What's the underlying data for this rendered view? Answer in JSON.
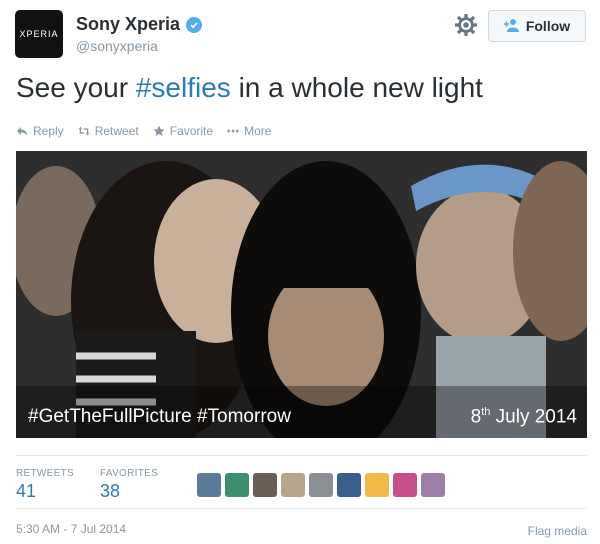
{
  "account": {
    "avatar_text": "XPERIA",
    "display_name": "Sony Xperia",
    "handle": "@sonyxperia",
    "verified": true,
    "follow_label": "Follow"
  },
  "tweet": {
    "text_before": "See your ",
    "hashtag": "#selfies",
    "text_after": " in a whole new light"
  },
  "actions": [
    {
      "label": "Reply",
      "icon": "reply-icon"
    },
    {
      "label": "Retweet",
      "icon": "retweet-icon"
    },
    {
      "label": "Favorite",
      "icon": "star-icon"
    },
    {
      "label": "More",
      "icon": "more-icon"
    }
  ],
  "media": {
    "caption_left": "#GetTheFullPicture #Tomorrow",
    "caption_right_day": "8",
    "caption_right_suffix": "th",
    "caption_right_rest": " July 2014"
  },
  "stats": {
    "retweets_label": "RETWEETS",
    "retweets_value": "41",
    "favorites_label": "FAVORITES",
    "favorites_value": "38"
  },
  "favoriters_colors": [
    "#5a7b9a",
    "#3e8f6f",
    "#6b5f55",
    "#b9a58c",
    "#8a8f96",
    "#3a5f8f",
    "#f2b94a",
    "#c64f8a",
    "#9c7fa8"
  ],
  "footer": {
    "timestamp": "5:30 AM - 7 Jul 2014",
    "flag_label": "Flag media"
  },
  "colors": {
    "link": "#2b7bb9",
    "verified": "#55acee",
    "muted": "#8899a6"
  }
}
